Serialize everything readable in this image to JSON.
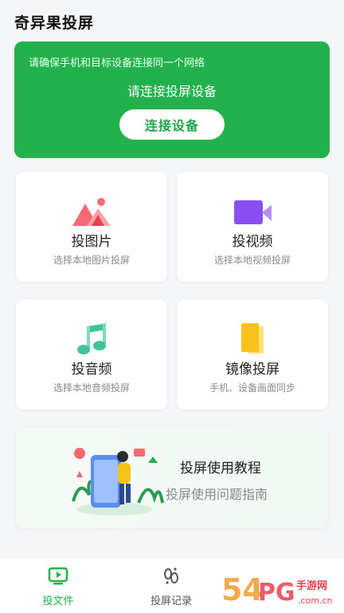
{
  "app": {
    "title": "奇异果投屏"
  },
  "banner": {
    "hint": "请确保手机和目标设备连接同一个网络",
    "title": "请连接投屏设备",
    "button": "连接设备"
  },
  "features": [
    {
      "title": "投图片",
      "subtitle": "选择本地图片投屏",
      "icon": "photo-icon"
    },
    {
      "title": "投视频",
      "subtitle": "选择本地视频投屏",
      "icon": "video-camera-icon"
    },
    {
      "title": "投音频",
      "subtitle": "选择本地音频投屏",
      "icon": "music-note-icon"
    },
    {
      "title": "镜像投屏",
      "subtitle": "手机、设备画面同步",
      "icon": "mirror-screens-icon"
    }
  ],
  "tutorial": {
    "title": "投屏使用教程",
    "subtitle": "投屏使用问题指南"
  },
  "tabbar": {
    "items": [
      {
        "label": "投文件",
        "icon": "tv-play-icon",
        "active": true
      },
      {
        "label": "投屏记录",
        "icon": "footprint-icon",
        "active": false
      }
    ]
  },
  "watermark": {
    "text": "54PG手游网",
    "domain": ".com.cn"
  },
  "colors": {
    "accent": "#22b14c",
    "background": "#f5f6f7"
  }
}
